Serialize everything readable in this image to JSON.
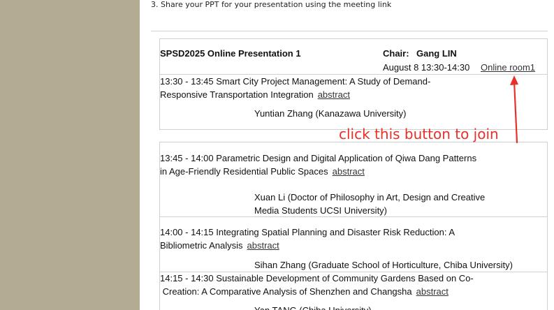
{
  "instruction": "3. Share your PPT for your presentation using the meeting link",
  "header": {
    "event": "SPSD2025  Online Presentation 1",
    "chair_label": "Chair:",
    "chair_name": "Gang LIN",
    "time": "August 8 13:30-14:30",
    "room_link": "Online room1"
  },
  "annotation": "click this button to join",
  "sessions": [
    {
      "title_line1": "13:30 - 13:45 Smart City Project Management: A Study of Demand-",
      "title_line2": "Responsive  Transportation Integration",
      "abstract": "abstract",
      "speaker_line1": "Yuntian  Zhang  (Kanazawa  University)",
      "speaker_line2": ""
    },
    {
      "title_line1": "13:45 - 14:00 Parametric Design and Digital Application of Qiwa Dang Patterns",
      "title_line2": "in  Age-Friendly Residential Public Spaces",
      "abstract": "abstract",
      "speaker_line1": "Xuan Li (Doctor of Philosophy in Art, Design and Creative",
      "speaker_line2": "Media Students UCSI University)"
    },
    {
      "title_line1": "14:00 - 14:15 Integrating Spatial Planning and Disaster Risk Reduction: A",
      "title_line2": "Bibliometric Analysis",
      "abstract": "abstract",
      "speaker_line1": "Sihan Zhang (Graduate School of Horticulture, Chiba University)",
      "speaker_line2": ""
    },
    {
      "title_line1": "14:15 - 14:30 Sustainable Development of Community Gardens Based on Co-",
      "title_line2": " Creation: A Comparative Analysis of Shenzhen and Changsha",
      "abstract": "abstract",
      "speaker_line1": "Yan TANG (Chiba University)",
      "speaker_line2": ""
    }
  ],
  "colors": {
    "left_band": "#b3ab92",
    "annotation": "#e8302a",
    "border": "#d0d0d0"
  }
}
